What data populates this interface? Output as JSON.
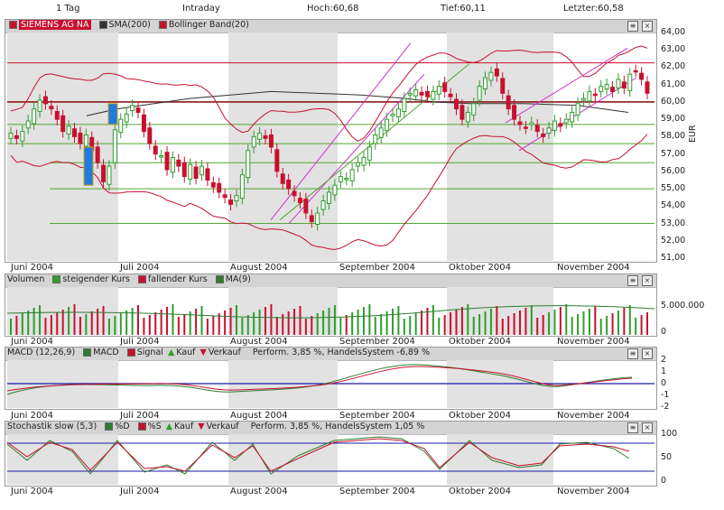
{
  "header": {
    "period": "1 Tag",
    "mode": "Intraday",
    "high": "Hoch:60,68",
    "low": "Tief:60,11",
    "last": "Letzter:60,58"
  },
  "legend_price": {
    "name": "SIEMENS AG NA",
    "sma": "SMA(200)",
    "bb": "Bollinger Band(20)"
  },
  "legend_vol": {
    "title": "Volumen",
    "up": "steigender Kurs",
    "down": "fallender Kurs",
    "ma": "MA(9)"
  },
  "legend_macd": {
    "title": "MACD (12,26,9)",
    "macd": "MACD",
    "signal": "Signal",
    "buy": "Kauf",
    "sell": "Verkauf",
    "perf": "Perform. 3,85 %, HandelsSystem -6,89 %"
  },
  "legend_stoch": {
    "title": "Stochastik slow (5,3)",
    "d": "%D",
    "s": "%S",
    "buy": "Kauf",
    "sell": "Verkauf",
    "perf": "Perform. 3,85 %, HandelsSystem 1,05 %"
  },
  "months": [
    "Juni 2004",
    "Juli 2004",
    "August 2004",
    "September 2004",
    "Oktober 2004",
    "November 2004"
  ],
  "price_ticks": [
    "64,00",
    "63,00",
    "62,00",
    "61,00",
    "60,00",
    "59,00",
    "58,00",
    "57,00",
    "56,00",
    "55,00",
    "54,00",
    "53,00",
    "52,00",
    "51,00"
  ],
  "price_unit": "EUR",
  "vol_ticks": [
    "5.000.000",
    "0"
  ],
  "macd_ticks": [
    "2",
    "1",
    "0",
    "-1",
    "-2"
  ],
  "stoch_ticks": [
    "100",
    "50",
    "0"
  ],
  "colors": {
    "up": "#2e9e2e",
    "down": "#c8102e",
    "band": "#c8102e",
    "sma": "#333333",
    "shade": "#e2e2e2",
    "grid": "#55a630",
    "macd": "#2e7d32",
    "signal": "#c8102e",
    "zero": "#1a1aa8",
    "channel": "#cc33cc"
  },
  "chart_data": {
    "type": "candlestick",
    "ylim": [
      51,
      64
    ],
    "closes": [
      58.2,
      57.9,
      58.3,
      58.9,
      59.6,
      60.1,
      59.9,
      59.6,
      59.0,
      58.3,
      58.6,
      58.0,
      57.6,
      58.1,
      57.2,
      56.5,
      55.4,
      56.3,
      58.4,
      59.0,
      59.3,
      59.8,
      59.4,
      58.3,
      57.6,
      57.0,
      56.9,
      56.1,
      56.8,
      56.3,
      55.7,
      56.4,
      55.6,
      56.3,
      55.5,
      55.1,
      54.8,
      54.5,
      54.1,
      54.6,
      55.8,
      57.2,
      58.0,
      58.2,
      57.9,
      57.4,
      56.0,
      55.3,
      55.0,
      54.6,
      54.2,
      53.6,
      53.1,
      53.6,
      54.3,
      54.8,
      55.2,
      55.7,
      55.6,
      56.1,
      56.5,
      56.8,
      57.4,
      58.1,
      58.5,
      59.0,
      59.3,
      59.6,
      60.2,
      60.5,
      60.7,
      60.4,
      60.3,
      60.6,
      60.9,
      60.6,
      60.3,
      59.6,
      59.0,
      59.4,
      59.9,
      60.9,
      61.4,
      61.7,
      61.5,
      60.5,
      59.6,
      59.0,
      58.7,
      58.5,
      58.8,
      58.3,
      58.0,
      58.5,
      58.9,
      58.6,
      59.0,
      59.4,
      59.9,
      60.2,
      60.6,
      60.4,
      60.9,
      61.0,
      60.6,
      61.3,
      60.8,
      61.6,
      61.8,
      61.3,
      60.5
    ],
    "sma200": [
      [
        96,
        59.2
      ],
      [
        130,
        59.6
      ],
      [
        210,
        60.2
      ],
      [
        300,
        60.6
      ],
      [
        400,
        60.4
      ],
      [
        450,
        60.2
      ],
      [
        480,
        60.0
      ],
      [
        520,
        59.9
      ],
      [
        580,
        59.9
      ],
      [
        640,
        59.8
      ],
      [
        696,
        59.4
      ]
    ],
    "hlines": [
      62.25,
      60.0,
      58.7,
      57.6,
      56.5,
      55.0,
      53.0
    ]
  }
}
